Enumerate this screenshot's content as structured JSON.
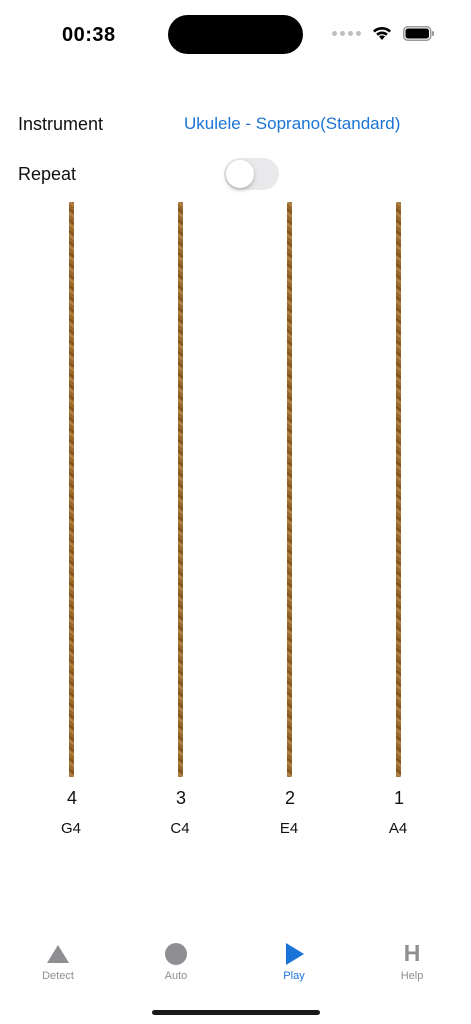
{
  "status": {
    "time": "00:38"
  },
  "settings": {
    "instrument_label": "Instrument",
    "instrument_value": "Ukulele - Soprano(Standard)",
    "repeat_label": "Repeat",
    "repeat_on": false
  },
  "strings": [
    {
      "number": "4",
      "note": "G4"
    },
    {
      "number": "3",
      "note": "C4"
    },
    {
      "number": "2",
      "note": "E4"
    },
    {
      "number": "1",
      "note": "A4"
    }
  ],
  "tabs": [
    {
      "label": "Detect",
      "icon": "triangle-icon"
    },
    {
      "label": "Auto",
      "icon": "circle-icon"
    },
    {
      "label": "Play",
      "icon": "play-icon",
      "active": true
    },
    {
      "label": "Help",
      "icon": "help-h-icon",
      "glyph": "H"
    }
  ],
  "colors": {
    "accent": "#1a73d6",
    "inactive": "#8e8e93",
    "string": "#9a6a2c"
  }
}
